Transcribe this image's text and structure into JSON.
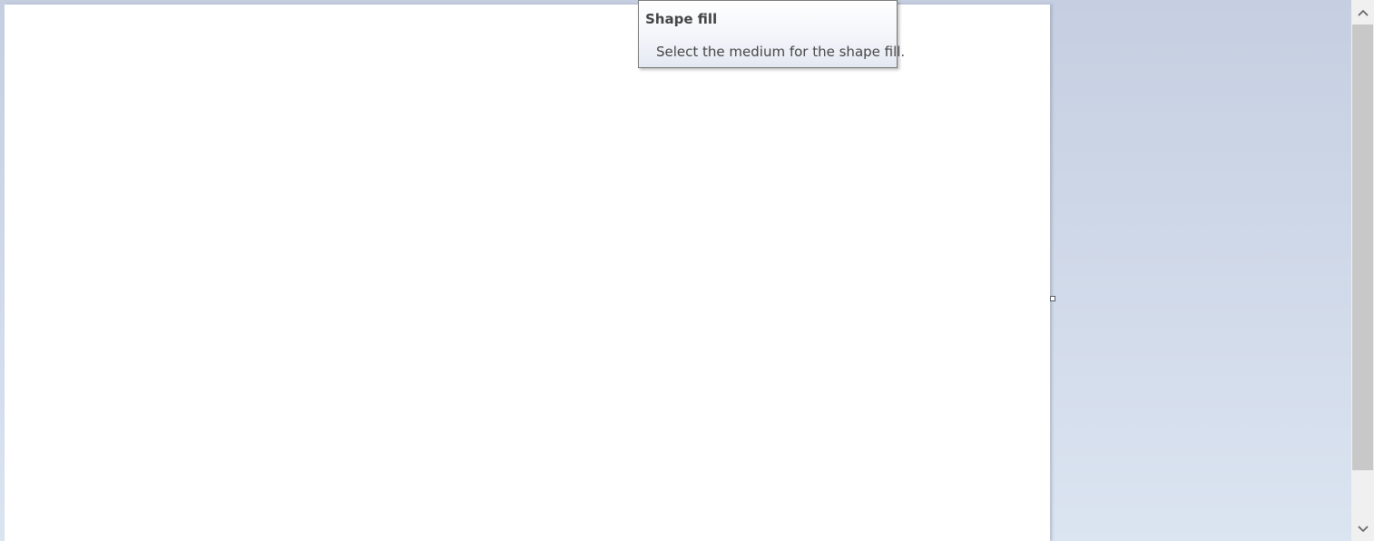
{
  "tooltip": {
    "title": "Shape fill",
    "description": "Select the medium for the shape fill."
  },
  "icons": {
    "scroll_up": "chevron-up-icon",
    "scroll_down": "chevron-down-icon"
  },
  "colors": {
    "workspace_top": "#c5cfe1",
    "workspace_bottom": "#dbe4f1",
    "canvas": "#ffffff",
    "tooltip_border": "#767676",
    "text": "#444444",
    "scrollbar_track": "#f0f0f0",
    "scrollbar_thumb": "#c8c8c8"
  }
}
